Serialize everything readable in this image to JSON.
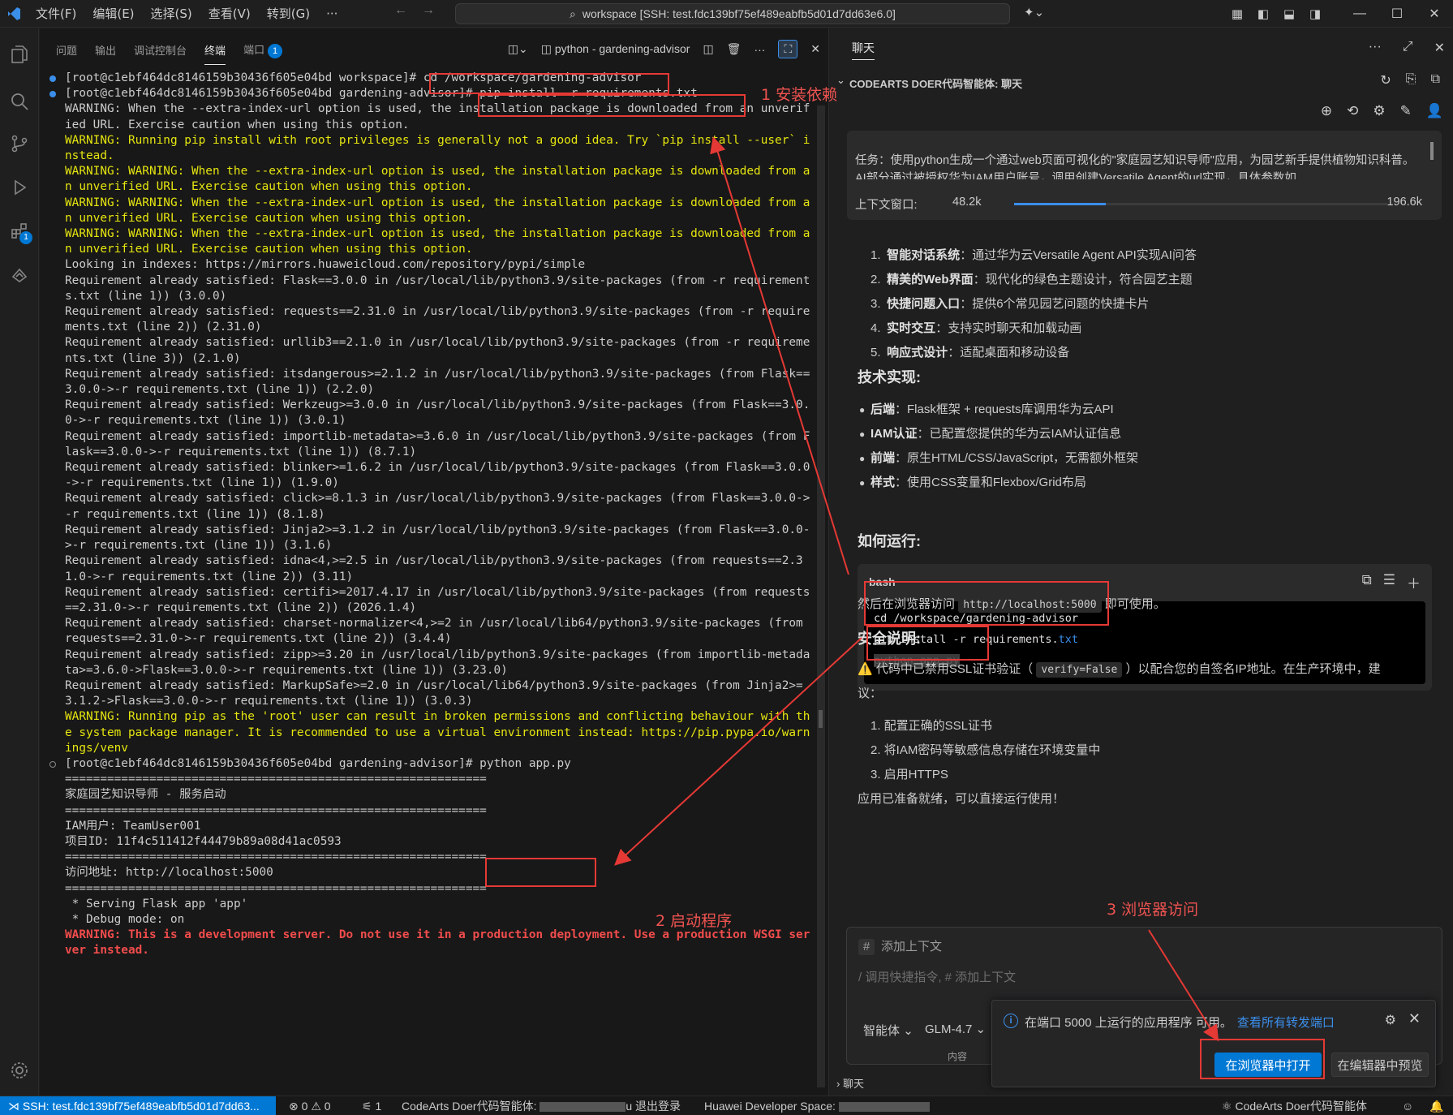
{
  "titlebar": {
    "menus": [
      "文件(F)",
      "编辑(E)",
      "选择(S)",
      "查看(V)",
      "转到(G)",
      "···"
    ],
    "command_center": "workspace [SSH: test.fdc139bf75ef489eabfb5d01d7dd63e6.0]"
  },
  "activity": {
    "extensions_badge": "1"
  },
  "panel": {
    "tabs": [
      "问题",
      "输出",
      "调试控制台",
      "终端",
      "端口"
    ],
    "ports_badge": "1",
    "terminal_name": "python - gardening-advisor"
  },
  "terminal": {
    "lines": [
      {
        "kind": "prompt",
        "text": "[root@c1ebf464dc8146159b30436f605e04bd workspace]# cd /workspace/gardening-advisor"
      },
      {
        "kind": "prompt",
        "text": "[root@c1ebf464dc8146159b30436f605e04bd gardening-advisor]# pip install -r requirements.txt"
      },
      {
        "kind": "normal",
        "text": "WARNING: When the --extra-index-url option is used, the installation package is downloaded from an unverified URL. Exercise caution when using this option."
      },
      {
        "kind": "warn",
        "text": "WARNING: Running pip install with root privileges is generally not a good idea. Try `pip install --user` instead."
      },
      {
        "kind": "warn",
        "text": "WARNING: WARNING: When the --extra-index-url option is used, the installation package is downloaded from an unverified URL. Exercise caution when using this option."
      },
      {
        "kind": "warn",
        "text": "WARNING: WARNING: When the --extra-index-url option is used, the installation package is downloaded from an unverified URL. Exercise caution when using this option."
      },
      {
        "kind": "warn",
        "text": "WARNING: WARNING: When the --extra-index-url option is used, the installation package is downloaded from an unverified URL. Exercise caution when using this option."
      },
      {
        "kind": "normal",
        "text": "Looking in indexes: https://mirrors.huaweicloud.com/repository/pypi/simple"
      },
      {
        "kind": "normal",
        "text": "Requirement already satisfied: Flask==3.0.0 in /usr/local/lib/python3.9/site-packages (from -r requirements.txt (line 1)) (3.0.0)"
      },
      {
        "kind": "normal",
        "text": "Requirement already satisfied: requests==2.31.0 in /usr/local/lib/python3.9/site-packages (from -r requirements.txt (line 2)) (2.31.0)"
      },
      {
        "kind": "normal",
        "text": "Requirement already satisfied: urllib3==2.1.0 in /usr/local/lib/python3.9/site-packages (from -r requirements.txt (line 3)) (2.1.0)"
      },
      {
        "kind": "normal",
        "text": "Requirement already satisfied: itsdangerous>=2.1.2 in /usr/local/lib/python3.9/site-packages (from Flask==3.0.0->-r requirements.txt (line 1)) (2.2.0)"
      },
      {
        "kind": "normal",
        "text": "Requirement already satisfied: Werkzeug>=3.0.0 in /usr/local/lib/python3.9/site-packages (from Flask==3.0.0->-r requirements.txt (line 1)) (3.0.1)"
      },
      {
        "kind": "normal",
        "text": "Requirement already satisfied: importlib-metadata>=3.6.0 in /usr/local/lib/python3.9/site-packages (from Flask==3.0.0->-r requirements.txt (line 1)) (8.7.1)"
      },
      {
        "kind": "normal",
        "text": "Requirement already satisfied: blinker>=1.6.2 in /usr/local/lib/python3.9/site-packages (from Flask==3.0.0->-r requirements.txt (line 1)) (1.9.0)"
      },
      {
        "kind": "normal",
        "text": "Requirement already satisfied: click>=8.1.3 in /usr/local/lib/python3.9/site-packages (from Flask==3.0.0->-r requirements.txt (line 1)) (8.1.8)"
      },
      {
        "kind": "normal",
        "text": "Requirement already satisfied: Jinja2>=3.1.2 in /usr/local/lib/python3.9/site-packages (from Flask==3.0.0->-r requirements.txt (line 1)) (3.1.6)"
      },
      {
        "kind": "normal",
        "text": "Requirement already satisfied: idna<4,>=2.5 in /usr/local/lib/python3.9/site-packages (from requests==2.31.0->-r requirements.txt (line 2)) (3.11)"
      },
      {
        "kind": "normal",
        "text": "Requirement already satisfied: certifi>=2017.4.17 in /usr/local/lib/python3.9/site-packages (from requests==2.31.0->-r requirements.txt (line 2)) (2026.1.4)"
      },
      {
        "kind": "normal",
        "text": "Requirement already satisfied: charset-normalizer<4,>=2 in /usr/local/lib64/python3.9/site-packages (from requests==2.31.0->-r requirements.txt (line 2)) (3.4.4)"
      },
      {
        "kind": "normal",
        "text": "Requirement already satisfied: zipp>=3.20 in /usr/local/lib/python3.9/site-packages (from importlib-metadata>=3.6.0->Flask==3.0.0->-r requirements.txt (line 1)) (3.23.0)"
      },
      {
        "kind": "normal",
        "text": "Requirement already satisfied: MarkupSafe>=2.0 in /usr/local/lib64/python3.9/site-packages (from Jinja2>=3.1.2->Flask==3.0.0->-r requirements.txt (line 1)) (3.0.3)"
      },
      {
        "kind": "warn",
        "text": "WARNING: Running pip as the 'root' user can result in broken permissions and conflicting behaviour with the system package manager. It is recommended to use a virtual environment instead: https://pip.pypa.io/warnings/venv"
      },
      {
        "kind": "prompt-hollow",
        "text": "[root@c1ebf464dc8146159b30436f605e04bd gardening-advisor]# python app.py"
      },
      {
        "kind": "normal",
        "text": "============================================================"
      },
      {
        "kind": "normal",
        "text": "家庭园艺知识导师 - 服务启动"
      },
      {
        "kind": "normal",
        "text": "============================================================"
      },
      {
        "kind": "normal",
        "text": "IAM用户: TeamUser001"
      },
      {
        "kind": "normal",
        "text": "项目ID: 11f4c511412f44479b89a08d41ac0593"
      },
      {
        "kind": "normal",
        "text": "============================================================"
      },
      {
        "kind": "normal",
        "text": "访问地址: http://localhost:5000"
      },
      {
        "kind": "normal",
        "text": "============================================================"
      },
      {
        "kind": "normal",
        "text": " * Serving Flask app 'app'"
      },
      {
        "kind": "normal",
        "text": " * Debug mode: on"
      },
      {
        "kind": "err",
        "text": "WARNING: This is a development server. Do not use it in a production deployment. Use a production WSGI server instead."
      }
    ]
  },
  "chat": {
    "tab": "聊天",
    "header": "CODEARTS DOER代码智能体: 聊天",
    "task_text": "任务：使用python生成一个通过web页面可视化的\"家庭园艺知识导师\"应用，为园艺新手提供植物知识科普。AI部分通过被授权华为IAM用户账号，调用创建Versatile Agent的url实现，具体参数如",
    "ctx_label": "上下文窗口:",
    "ctx_used": "48.2k",
    "ctx_total": "196.6k",
    "ctx_fraction": 0.245,
    "features": [
      {
        "num": "1.",
        "bold": "智能对话系统",
        "rest": "：通过华为云Versatile Agent API实现AI问答"
      },
      {
        "num": "2.",
        "bold": "精美的Web界面",
        "rest": "：现代化的绿色主题设计，符合园艺主题"
      },
      {
        "num": "3.",
        "bold": "快捷问题入口",
        "rest": "：提供6个常见园艺问题的快捷卡片"
      },
      {
        "num": "4.",
        "bold": "实时交互",
        "rest": "：支持实时聊天和加载动画"
      },
      {
        "num": "5.",
        "bold": "响应式设计",
        "rest": "：适配桌面和移动设备"
      }
    ],
    "tech_heading": "技术实现:",
    "tech": [
      {
        "bold": "后端",
        "rest": "：Flask框架 + requests库调用华为云API"
      },
      {
        "bold": "IAM认证",
        "rest": "：已配置您提供的华为云IAM认证信息"
      },
      {
        "bold": "前端",
        "rest": "：原生HTML/CSS/JavaScript，无需额外框架"
      },
      {
        "bold": "样式",
        "rest": "：使用CSS变量和Flexbox/Grid布局"
      }
    ],
    "run_heading": "如何运行:",
    "code_lang": "bash",
    "code_line1": "cd /workspace/gardening-advisor",
    "code_line2_cmd": "pip install ",
    "code_line2_flag": "-r",
    "code_line2_file": " requirements.",
    "code_line2_ext": "txt",
    "code_line3": "python app.py",
    "visit_pre": "然后在浏览器访问",
    "visit_url": "http://localhost:5000",
    "visit_post": "即可使用。",
    "security_heading": "安全说明:",
    "security_pre": "⚠️ 代码中已禁用SSL证书验证（",
    "security_code": "verify=False",
    "security_post": "）以配合您的自签名IP地址。在生产环境中，建",
    "security_post2": "议：",
    "advice": [
      "1. 配置正确的SSL证书",
      "2. 将IAM密码等敏感信息存储在环境变量中",
      "3. 启用HTTPS"
    ],
    "ready": "应用已准备就绪，可以直接运行使用！",
    "input_ctx": "添加上下文",
    "input_placeholder": "/ 调用快捷指令, # 添加上下文",
    "agent_mode": "智能体",
    "model": "GLM-4.7",
    "context_hint": "内容",
    "footer": "聊天"
  },
  "toast": {
    "message": "在端口 5000 上运行的应用程序 可用。",
    "link": "查看所有转发端口",
    "open_browser": "在浏览器中打开",
    "preview_editor": "在编辑器中预览"
  },
  "status": {
    "remote": "SSH: test.fdc139bf75ef489eabfb5d01d7dd63...",
    "problems": "0",
    "warnings": "0",
    "ports": "1",
    "codearts": "CodeArts Doer代码智能体:",
    "logout": "u 退出登录",
    "space": "Huawei Developer Space:",
    "right": "CodeArts Doer代码智能体"
  },
  "annotations": {
    "step1": "1 安装依赖",
    "step2": "2 启动程序",
    "step3": "3 浏览器访问",
    "color": "#e53935"
  }
}
